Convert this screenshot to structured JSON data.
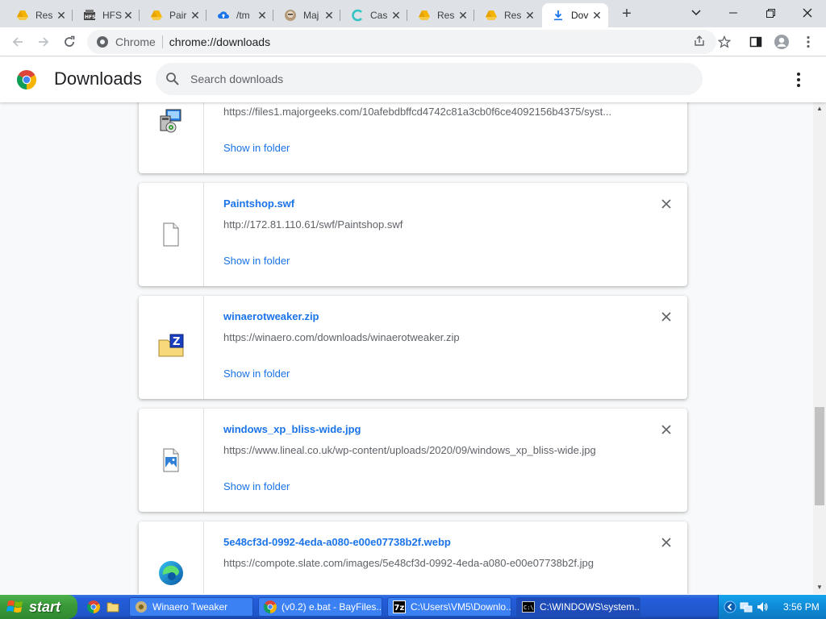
{
  "browser": {
    "tabs": [
      {
        "label": "Res",
        "icon": "gdrive-icon"
      },
      {
        "label": "HFS",
        "icon": "hfs-icon"
      },
      {
        "label": "Pair",
        "icon": "gdrive-icon"
      },
      {
        "label": "/tm",
        "icon": "upload-icon"
      },
      {
        "label": "Maj",
        "icon": "majorgeeks-icon"
      },
      {
        "label": "Cas",
        "icon": "casetext-icon"
      },
      {
        "label": "Res",
        "icon": "gdrive-icon"
      },
      {
        "label": "Res",
        "icon": "gdrive-icon"
      },
      {
        "label": "Dov",
        "icon": "download-icon",
        "active": true
      }
    ],
    "omnibox": {
      "site_label": "Chrome",
      "url": "chrome://downloads"
    }
  },
  "downloads": {
    "title": "Downloads",
    "search_placeholder": "Search downloads",
    "items": [
      {
        "name": "",
        "url": "https://files1.majorgeeks.com/10afebdbffcd4742c81a3cb0f6ce4092156b4375/syst...",
        "action": "Show in folder",
        "icon": "installer-icon"
      },
      {
        "name": "Paintshop.swf",
        "url": "http://172.81.110.61/swf/Paintshop.swf",
        "action": "Show in folder",
        "icon": "file-icon"
      },
      {
        "name": "winaerotweaker.zip",
        "url": "https://winaero.com/downloads/winaerotweaker.zip",
        "action": "Show in folder",
        "icon": "zip-icon"
      },
      {
        "name": "windows_xp_bliss-wide.jpg",
        "url": "https://www.lineal.co.uk/wp-content/uploads/2020/09/windows_xp_bliss-wide.jpg",
        "action": "Show in folder",
        "icon": "image-icon"
      },
      {
        "name": "5e48cf3d-0992-4eda-a080-e00e07738b2f.webp",
        "url": "https://compote.slate.com/images/5e48cf3d-0992-4eda-a080-e00e07738b2f.jpg",
        "action": "",
        "icon": "edge-icon"
      }
    ]
  },
  "taskbar": {
    "start_label": "start",
    "tasks": [
      {
        "label": "Winaero Tweaker",
        "icon": "winaero-icon"
      },
      {
        "label": "(v0.2) e.bat - BayFiles...",
        "icon": "chrome-icon"
      },
      {
        "label": "C:\\Users\\VM5\\Downlo...",
        "icon": "7zip-icon"
      },
      {
        "label": "C:\\WINDOWS\\system...",
        "icon": "cmd-icon",
        "active": true
      }
    ],
    "clock": "3:56 PM"
  },
  "colors": {
    "link": "#1a73e8",
    "text_secondary": "#5f6368",
    "xp_blue": "#245edb",
    "xp_green": "#3a9b3a"
  }
}
